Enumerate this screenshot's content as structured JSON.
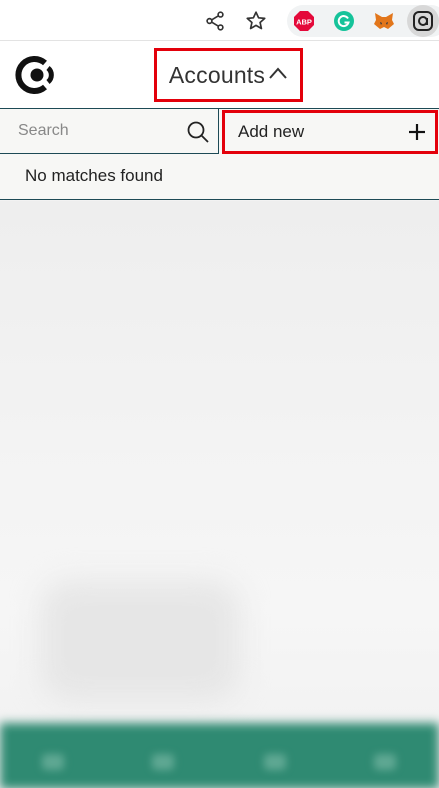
{
  "browser": {
    "share_icon": "share-icon",
    "bookmark_icon": "star-icon",
    "extensions": [
      {
        "name": "adblock-plus-icon",
        "label": "ABP",
        "color": "#e4093a"
      },
      {
        "name": "grammarly-icon",
        "color": "#15c39a"
      },
      {
        "name": "metamask-icon",
        "color": "#e2761b"
      },
      {
        "name": "wallet-extension-icon",
        "active": true
      }
    ]
  },
  "header": {
    "logo_icon": "wallet-logo-icon",
    "accounts_label": "Accounts",
    "caret_icon": "chevron-up-icon"
  },
  "accounts_panel": {
    "search": {
      "placeholder": "Search",
      "value": "",
      "icon": "search-icon"
    },
    "add_new": {
      "label": "Add new",
      "icon": "plus-icon"
    },
    "empty_message": "No matches found"
  },
  "colors": {
    "highlight": "#e3000b",
    "panel_border": "#1d4a55",
    "nav_bar": "#2f8a72"
  }
}
